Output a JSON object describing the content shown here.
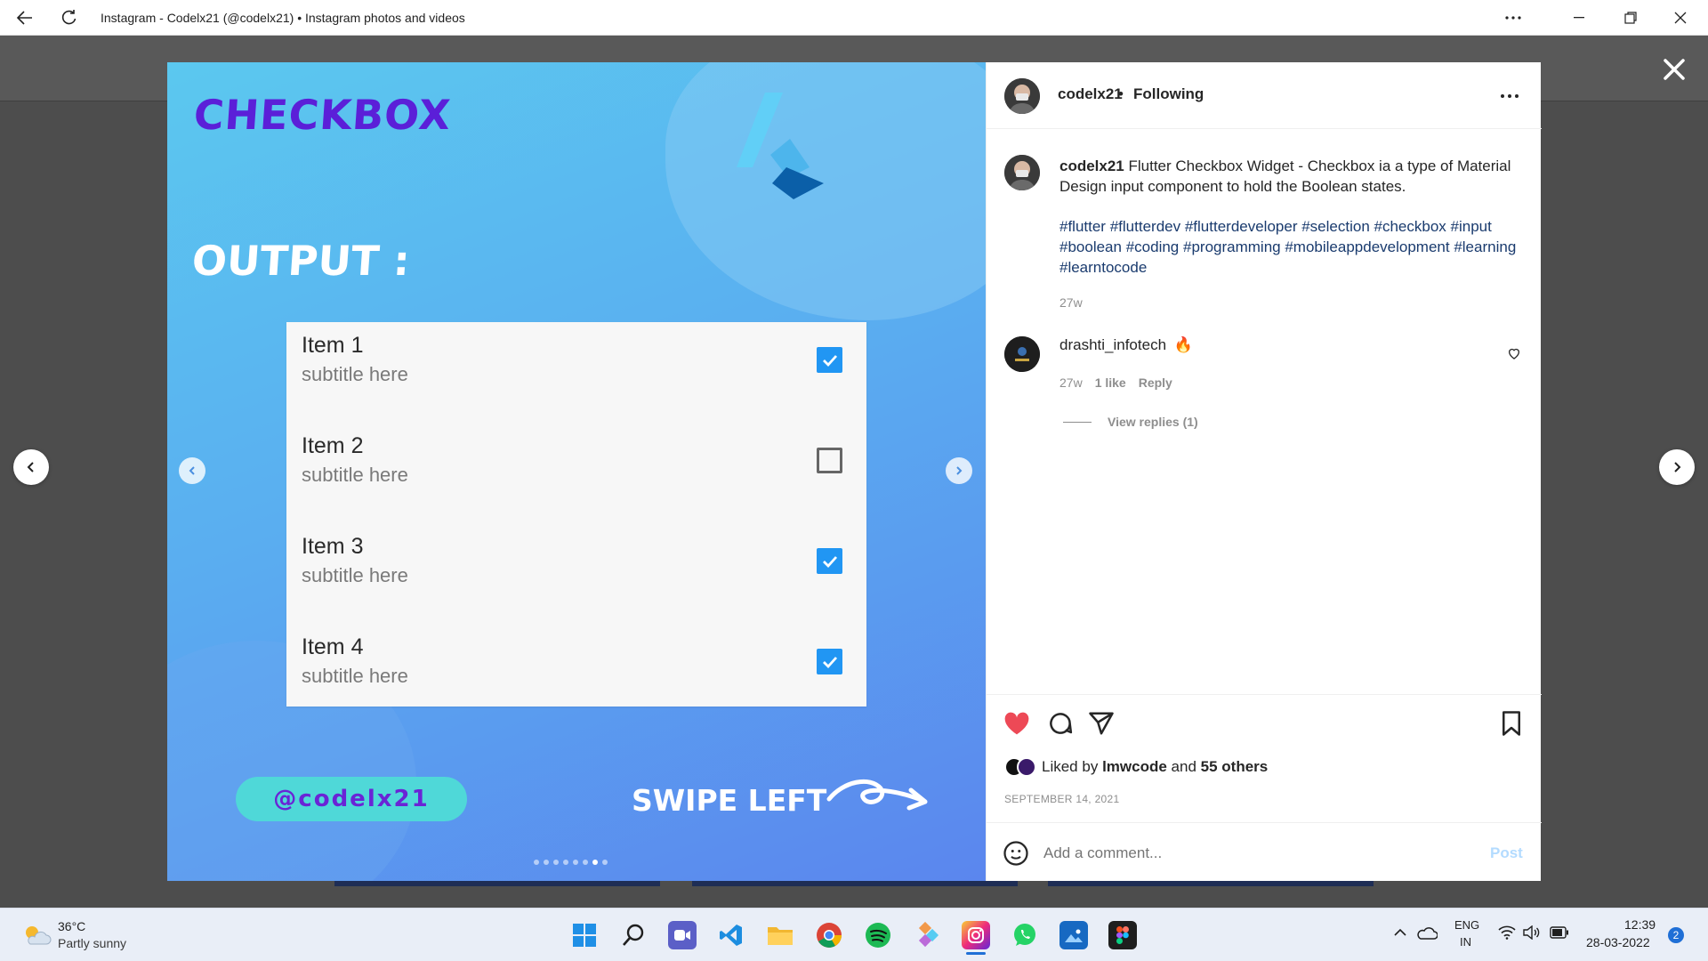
{
  "window": {
    "title": "Instagram - Codelx21 (@codelx21) • Instagram photos and videos"
  },
  "post": {
    "username": "codelx21",
    "follow_status": "Following",
    "separator": "•",
    "caption": "Flutter Checkbox Widget - Checkbox ia a type of Material Design input component to hold the Boolean states.",
    "hashtags": [
      "#flutter",
      "#flutterdev",
      "#flutterdeveloper",
      "#selection",
      "#checkbox",
      "#input",
      "#boolean",
      "#coding",
      "#programming",
      "#mobileappdevelopment",
      "#learning",
      "#learntocode"
    ],
    "caption_age": "27w",
    "comment": {
      "username": "drashti_infotech",
      "emoji": "🔥",
      "age": "27w",
      "likes": "1 like",
      "reply": "Reply",
      "view_replies": "View replies (1)"
    },
    "liked_by_prefix": "Liked by",
    "liked_by_user": "lmwcode",
    "liked_by_and": "and",
    "liked_by_others": "55 others",
    "date": "SEPTEMBER 14, 2021",
    "comment_placeholder": "Add a comment...",
    "post_button": "Post"
  },
  "media": {
    "heading": "CHECKBOX",
    "subheading": "OUTPUT :",
    "items": [
      {
        "title": "Item 1",
        "subtitle": "subtitle here",
        "checked": true
      },
      {
        "title": "Item 2",
        "subtitle": "subtitle here",
        "checked": false
      },
      {
        "title": "Item 3",
        "subtitle": "subtitle here",
        "checked": true
      },
      {
        "title": "Item 4",
        "subtitle": "subtitle here",
        "checked": true
      }
    ],
    "handle": "@codelx21",
    "swipe": "SWIPE LEFT",
    "slide_count": 8,
    "active_slide": 7
  },
  "taskbar": {
    "temperature": "36°C",
    "weather": "Partly sunny",
    "language": "ENG",
    "region": "IN",
    "time": "12:39",
    "date": "28-03-2022",
    "notifications": "2"
  },
  "colors": {
    "accent_blue": "#2196f3",
    "heart_red": "#ed4956",
    "link_blue": "#0095f6"
  }
}
